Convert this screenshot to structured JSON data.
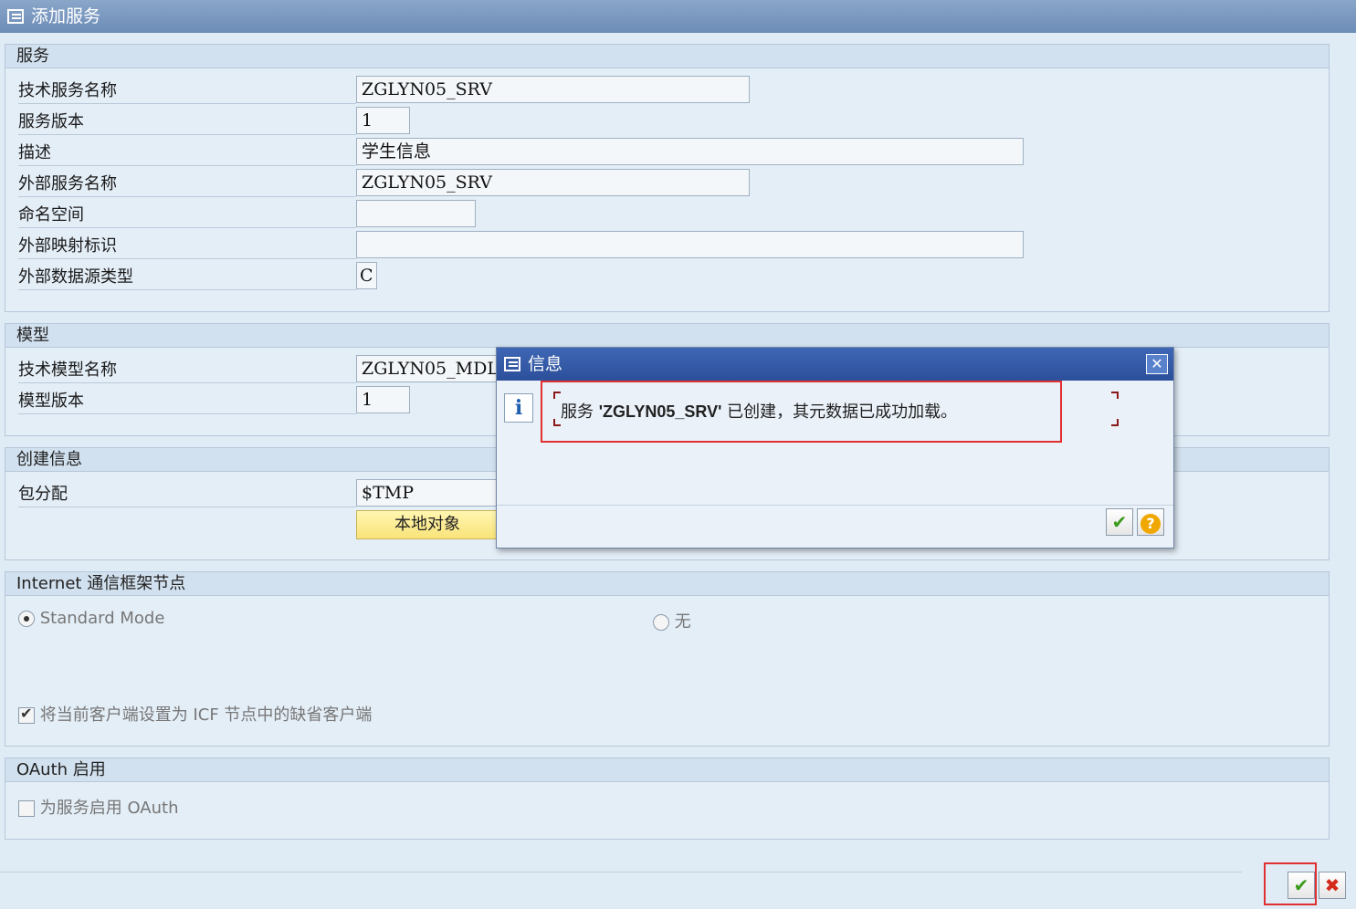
{
  "window": {
    "title": "添加服务"
  },
  "service_group": {
    "title": "服务",
    "fields": [
      {
        "label": "技术服务名称",
        "value": "ZGLYN05_SRV"
      },
      {
        "label": "服务版本",
        "value": "1"
      },
      {
        "label": "描述",
        "value": "学生信息"
      },
      {
        "label": "外部服务名称",
        "value": "ZGLYN05_SRV"
      },
      {
        "label": "命名空间",
        "value": ""
      },
      {
        "label": "外部映射标识",
        "value": ""
      },
      {
        "label": "外部数据源类型",
        "value": "C"
      }
    ]
  },
  "model_group": {
    "title": "模型",
    "fields": [
      {
        "label": "技术模型名称",
        "value": "ZGLYN05_MDL"
      },
      {
        "label": "模型版本",
        "value": "1"
      }
    ]
  },
  "creation_group": {
    "title": "创建信息",
    "package_label": "包分配",
    "package_value": "$TMP",
    "local_object_button": "本地对象"
  },
  "icf_group": {
    "title": "Internet 通信框架节点",
    "radio_standard": "Standard Mode",
    "radio_none": "无",
    "checkbox_default_client": "将当前客户端设置为 ICF 节点中的缺省客户端"
  },
  "oauth_group": {
    "title": "OAuth 启用",
    "checkbox_enable": "为服务启用 OAuth"
  },
  "dialog": {
    "title": "信息",
    "info_icon": "i",
    "message_prefix": "服务 ",
    "message_service": "'ZGLYN05_SRV'",
    "message_suffix": " 已创建，其元数据已成功加载。",
    "close_glyph": "✕",
    "ok_glyph": "✔",
    "help_glyph": "?"
  },
  "footer": {
    "ok_glyph": "✔",
    "cancel_glyph": "✖"
  },
  "colors": {
    "background": "#dfebf5",
    "title_bar": "#6c8cb7",
    "dialog_title": "#2c4f9a",
    "highlight_red": "#e03030"
  }
}
